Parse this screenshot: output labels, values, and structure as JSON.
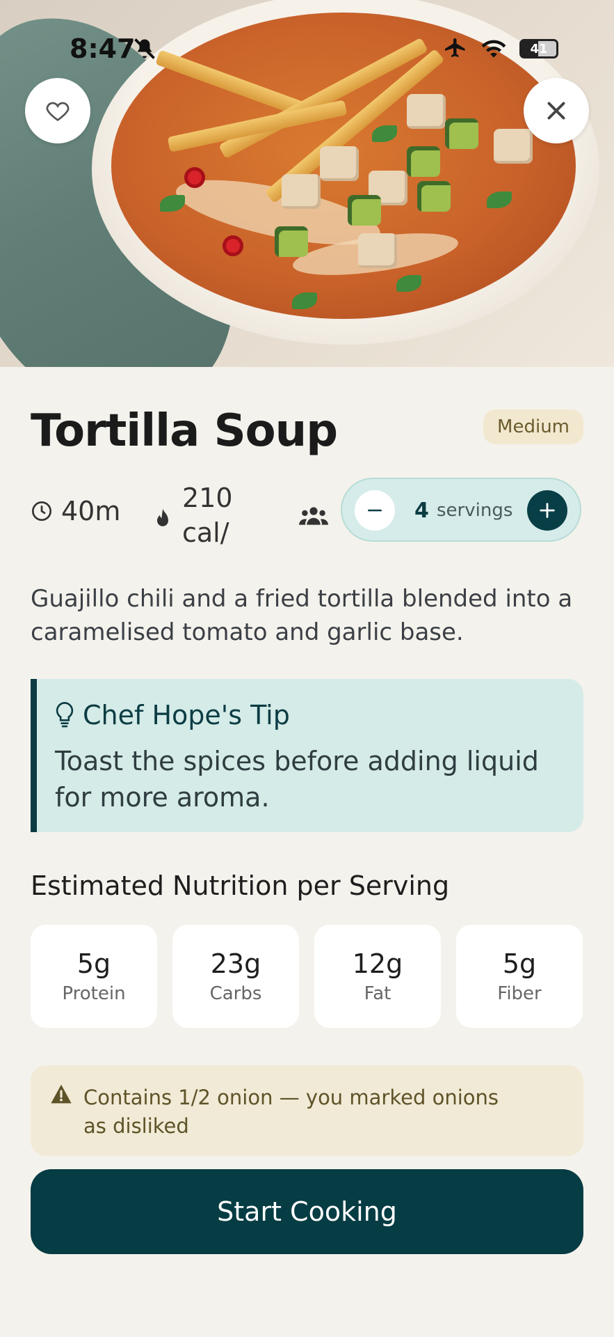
{
  "status_bar": {
    "time": "8:47",
    "battery": "41",
    "icons": [
      "bell-slash-icon",
      "airplane-icon",
      "wifi-icon",
      "battery-icon"
    ]
  },
  "hero": {
    "image_alt": "Bowl of tortilla soup topped with tortilla strips, tofu, avocado and cilantro",
    "favorite_icon": "heart-outline-icon",
    "close_icon": "close-icon"
  },
  "recipe": {
    "title": "Tortilla Soup",
    "difficulty": "Medium",
    "time": "40m",
    "calories": "210 cal/",
    "description": "Guajillo chili and a fried tortilla blended into a caramelised tomato and garlic base."
  },
  "servings": {
    "count": "4",
    "label": "servings"
  },
  "tip": {
    "title": "Chef Hope's Tip",
    "body": "Toast the spices before adding liquid for more aroma."
  },
  "nutrition": {
    "title": "Estimated Nutrition per Serving",
    "items": [
      {
        "value": "5g",
        "label": "Protein"
      },
      {
        "value": "23g",
        "label": "Carbs"
      },
      {
        "value": "12g",
        "label": "Fat"
      },
      {
        "value": "5g",
        "label": "Fiber"
      }
    ]
  },
  "warning": {
    "text": "Contains 1/2 onion — you marked onions as disliked"
  },
  "cta": {
    "label": "Start Cooking"
  },
  "colors": {
    "primary": "#063c43",
    "tip_bg": "#d5ebe8",
    "warning_bg": "#f1ead6",
    "badge_bg": "#f1e8cf"
  }
}
